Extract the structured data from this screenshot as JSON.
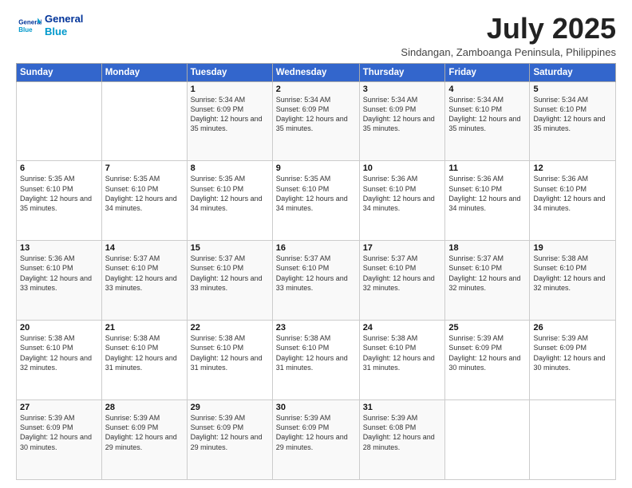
{
  "logo": {
    "line1": "General",
    "line2": "Blue"
  },
  "title": "July 2025",
  "subtitle": "Sindangan, Zamboanga Peninsula, Philippines",
  "days_of_week": [
    "Sunday",
    "Monday",
    "Tuesday",
    "Wednesday",
    "Thursday",
    "Friday",
    "Saturday"
  ],
  "weeks": [
    [
      {
        "day": "",
        "info": ""
      },
      {
        "day": "",
        "info": ""
      },
      {
        "day": "1",
        "info": "Sunrise: 5:34 AM\nSunset: 6:09 PM\nDaylight: 12 hours and 35 minutes."
      },
      {
        "day": "2",
        "info": "Sunrise: 5:34 AM\nSunset: 6:09 PM\nDaylight: 12 hours and 35 minutes."
      },
      {
        "day": "3",
        "info": "Sunrise: 5:34 AM\nSunset: 6:09 PM\nDaylight: 12 hours and 35 minutes."
      },
      {
        "day": "4",
        "info": "Sunrise: 5:34 AM\nSunset: 6:10 PM\nDaylight: 12 hours and 35 minutes."
      },
      {
        "day": "5",
        "info": "Sunrise: 5:34 AM\nSunset: 6:10 PM\nDaylight: 12 hours and 35 minutes."
      }
    ],
    [
      {
        "day": "6",
        "info": "Sunrise: 5:35 AM\nSunset: 6:10 PM\nDaylight: 12 hours and 35 minutes."
      },
      {
        "day": "7",
        "info": "Sunrise: 5:35 AM\nSunset: 6:10 PM\nDaylight: 12 hours and 34 minutes."
      },
      {
        "day": "8",
        "info": "Sunrise: 5:35 AM\nSunset: 6:10 PM\nDaylight: 12 hours and 34 minutes."
      },
      {
        "day": "9",
        "info": "Sunrise: 5:35 AM\nSunset: 6:10 PM\nDaylight: 12 hours and 34 minutes."
      },
      {
        "day": "10",
        "info": "Sunrise: 5:36 AM\nSunset: 6:10 PM\nDaylight: 12 hours and 34 minutes."
      },
      {
        "day": "11",
        "info": "Sunrise: 5:36 AM\nSunset: 6:10 PM\nDaylight: 12 hours and 34 minutes."
      },
      {
        "day": "12",
        "info": "Sunrise: 5:36 AM\nSunset: 6:10 PM\nDaylight: 12 hours and 34 minutes."
      }
    ],
    [
      {
        "day": "13",
        "info": "Sunrise: 5:36 AM\nSunset: 6:10 PM\nDaylight: 12 hours and 33 minutes."
      },
      {
        "day": "14",
        "info": "Sunrise: 5:37 AM\nSunset: 6:10 PM\nDaylight: 12 hours and 33 minutes."
      },
      {
        "day": "15",
        "info": "Sunrise: 5:37 AM\nSunset: 6:10 PM\nDaylight: 12 hours and 33 minutes."
      },
      {
        "day": "16",
        "info": "Sunrise: 5:37 AM\nSunset: 6:10 PM\nDaylight: 12 hours and 33 minutes."
      },
      {
        "day": "17",
        "info": "Sunrise: 5:37 AM\nSunset: 6:10 PM\nDaylight: 12 hours and 32 minutes."
      },
      {
        "day": "18",
        "info": "Sunrise: 5:37 AM\nSunset: 6:10 PM\nDaylight: 12 hours and 32 minutes."
      },
      {
        "day": "19",
        "info": "Sunrise: 5:38 AM\nSunset: 6:10 PM\nDaylight: 12 hours and 32 minutes."
      }
    ],
    [
      {
        "day": "20",
        "info": "Sunrise: 5:38 AM\nSunset: 6:10 PM\nDaylight: 12 hours and 32 minutes."
      },
      {
        "day": "21",
        "info": "Sunrise: 5:38 AM\nSunset: 6:10 PM\nDaylight: 12 hours and 31 minutes."
      },
      {
        "day": "22",
        "info": "Sunrise: 5:38 AM\nSunset: 6:10 PM\nDaylight: 12 hours and 31 minutes."
      },
      {
        "day": "23",
        "info": "Sunrise: 5:38 AM\nSunset: 6:10 PM\nDaylight: 12 hours and 31 minutes."
      },
      {
        "day": "24",
        "info": "Sunrise: 5:38 AM\nSunset: 6:10 PM\nDaylight: 12 hours and 31 minutes."
      },
      {
        "day": "25",
        "info": "Sunrise: 5:39 AM\nSunset: 6:09 PM\nDaylight: 12 hours and 30 minutes."
      },
      {
        "day": "26",
        "info": "Sunrise: 5:39 AM\nSunset: 6:09 PM\nDaylight: 12 hours and 30 minutes."
      }
    ],
    [
      {
        "day": "27",
        "info": "Sunrise: 5:39 AM\nSunset: 6:09 PM\nDaylight: 12 hours and 30 minutes."
      },
      {
        "day": "28",
        "info": "Sunrise: 5:39 AM\nSunset: 6:09 PM\nDaylight: 12 hours and 29 minutes."
      },
      {
        "day": "29",
        "info": "Sunrise: 5:39 AM\nSunset: 6:09 PM\nDaylight: 12 hours and 29 minutes."
      },
      {
        "day": "30",
        "info": "Sunrise: 5:39 AM\nSunset: 6:09 PM\nDaylight: 12 hours and 29 minutes."
      },
      {
        "day": "31",
        "info": "Sunrise: 5:39 AM\nSunset: 6:08 PM\nDaylight: 12 hours and 28 minutes."
      },
      {
        "day": "",
        "info": ""
      },
      {
        "day": "",
        "info": ""
      }
    ]
  ]
}
